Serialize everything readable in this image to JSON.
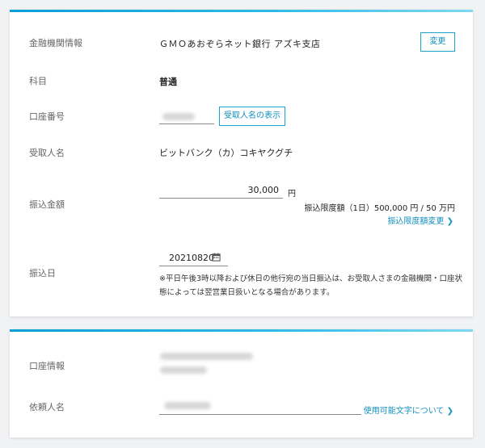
{
  "bank": {
    "label": "金融機関情報",
    "name": "ＧＭＯあおぞらネット銀行 アズキ支店",
    "change_button": "変更"
  },
  "account_type": {
    "label": "科目",
    "value": "普通"
  },
  "account_number": {
    "label": "口座番号",
    "show_name_button": "受取人名の表示"
  },
  "recipient": {
    "label": "受取人名",
    "value": "ビットバンク（カ）コキヤクグチ"
  },
  "amount": {
    "label": "振込金額",
    "value": "30,000",
    "unit": "円",
    "limit_text": "振込限度額（1日）500,000 円 / 50 万円",
    "limit_change_link": "振込限度額変更 ❯"
  },
  "transfer_date": {
    "label": "振込日",
    "value": "20210820",
    "note_line1": "※平日午後3時以降および休日の他行宛の当日振込は、お受取人さまの金融機関・口座状",
    "note_line2": "態によっては翌営業日扱いとなる場合があります。"
  },
  "account_info": {
    "label": "口座情報"
  },
  "sender": {
    "label": "依頼人名",
    "usable_chars_link": "使用可能文字について ❯"
  },
  "colors": {
    "accent": "#1aa3cf",
    "link": "#1190bf"
  }
}
